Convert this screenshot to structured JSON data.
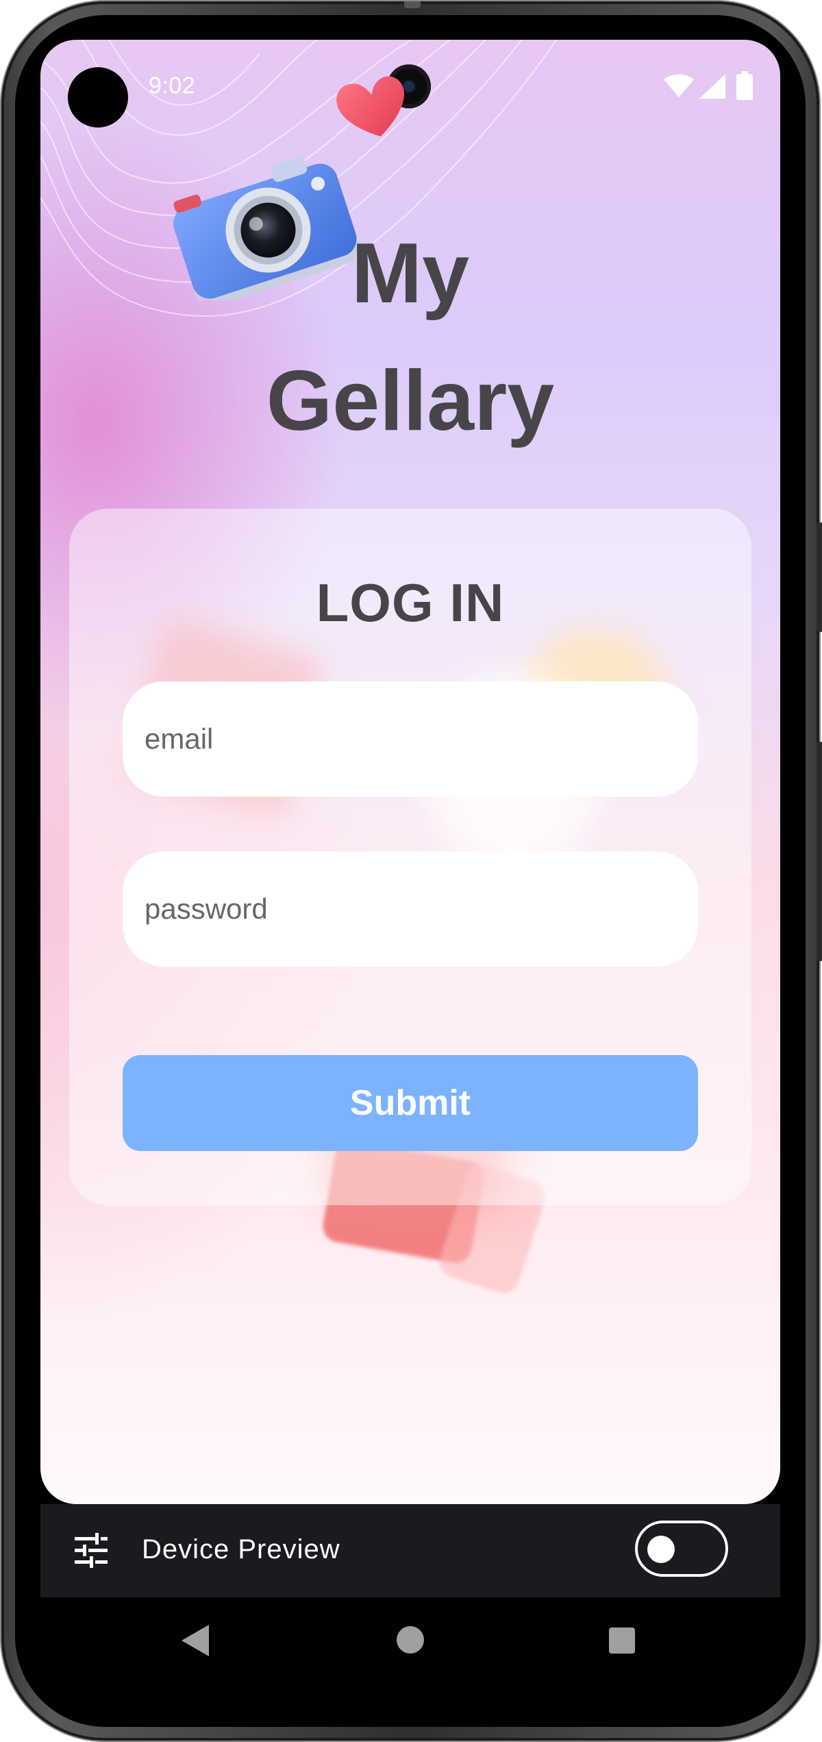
{
  "status_bar": {
    "time": "9:02",
    "icons": [
      "wifi-icon",
      "cell-signal-icon",
      "battery-icon"
    ]
  },
  "app": {
    "title": "My\nGellary"
  },
  "login": {
    "heading": "LOG IN",
    "email_placeholder": "email",
    "email_value": "",
    "password_placeholder": "password",
    "password_value": "",
    "submit_label": "Submit"
  },
  "device_preview": {
    "label": "Device Preview",
    "toggle_on": false
  },
  "nav_bar": {
    "buttons": [
      "back-icon",
      "home-icon",
      "recents-icon"
    ]
  },
  "colors": {
    "title_text": "#474548",
    "submit_button": "#7bb3fe",
    "device_preview_bar": "#1b1b1f"
  }
}
